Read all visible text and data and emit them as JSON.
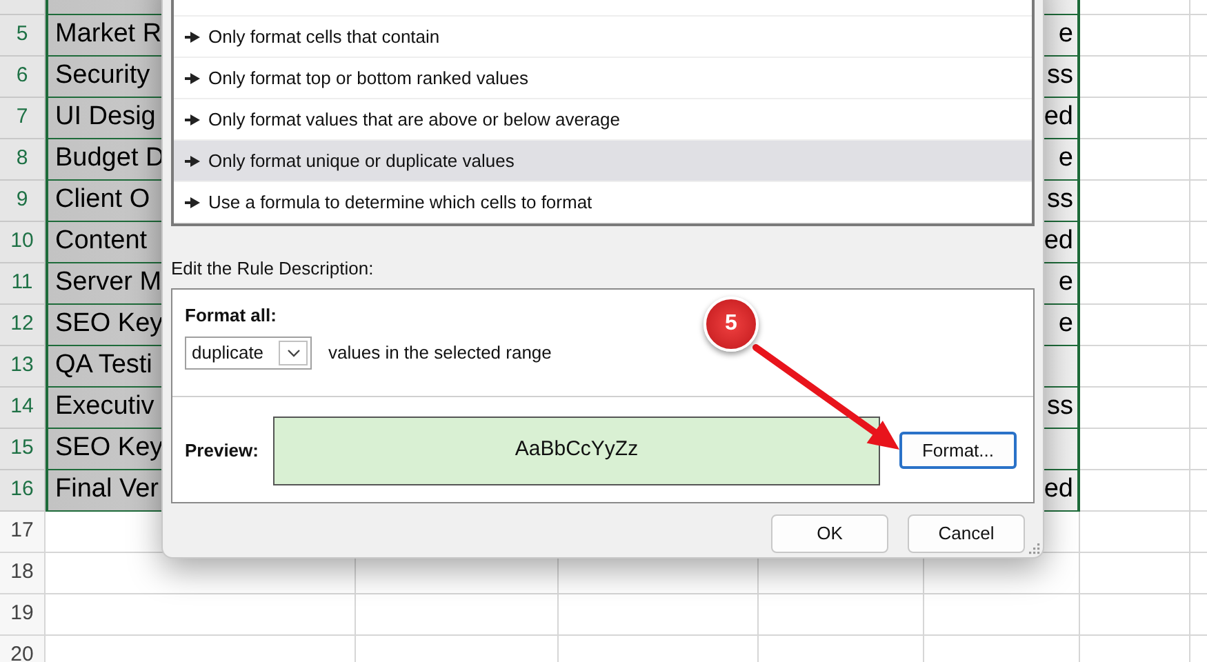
{
  "sheet": {
    "rows": [
      {
        "selected": true
      },
      {
        "number": "5",
        "cell_a": "Market R",
        "cell_e": "e",
        "selected": true
      },
      {
        "number": "6",
        "cell_a": "Security",
        "cell_e": "ss",
        "selected": true
      },
      {
        "number": "7",
        "cell_a": "UI Desig",
        "cell_e": "ed",
        "selected": true
      },
      {
        "number": "8",
        "cell_a": "Budget D",
        "cell_e": "e",
        "selected": true
      },
      {
        "number": "9",
        "cell_a": "Client O",
        "cell_e": "ss",
        "selected": true
      },
      {
        "number": "10",
        "cell_a": "Content",
        "cell_e": "ed",
        "selected": true
      },
      {
        "number": "11",
        "cell_a": "Server M",
        "cell_e": "e",
        "selected": true
      },
      {
        "number": "12",
        "cell_a": "SEO Key",
        "cell_e": "e",
        "selected": true
      },
      {
        "number": "13",
        "cell_a": "QA Testi",
        "selected": true
      },
      {
        "number": "14",
        "cell_a": "Executiv",
        "cell_e": "ss",
        "selected": true
      },
      {
        "number": "15",
        "cell_a": "SEO Key",
        "selected": true
      },
      {
        "number": "16",
        "cell_a": "Final Ver",
        "cell_e": "ed",
        "selected": true
      },
      {
        "number": "17",
        "selected": false
      },
      {
        "number": "18",
        "selected": false
      },
      {
        "number": "19",
        "selected": false
      },
      {
        "number": "20",
        "selected": false
      }
    ]
  },
  "dialog": {
    "rule_types": [
      {
        "label": "Only format cells that contain",
        "selected": false
      },
      {
        "label": "Only format top or bottom ranked values",
        "selected": false
      },
      {
        "label": "Only format values that are above or below average",
        "selected": false
      },
      {
        "label": "Only format unique or duplicate values",
        "selected": true
      },
      {
        "label": "Use a formula to determine which cells to format",
        "selected": false
      }
    ],
    "edit_label": "Edit the Rule Description:",
    "format_all_label": "Format all:",
    "dropdown": {
      "value": "duplicate"
    },
    "dropdown_suffix": "values in the selected range",
    "preview_label": "Preview:",
    "preview_text": "AaBbCcYyZz",
    "format_button": "Format...",
    "buttons": [
      "OK",
      "Cancel"
    ]
  },
  "annotation": {
    "badge": "5"
  }
}
